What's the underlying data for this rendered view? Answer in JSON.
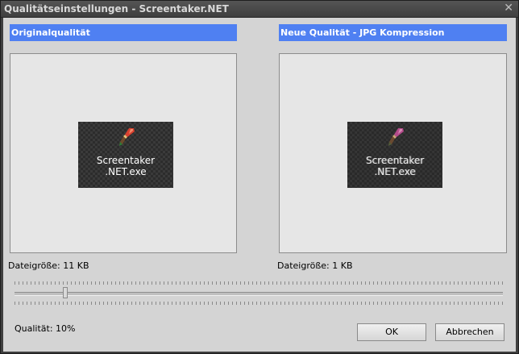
{
  "window": {
    "title": "Qualitätseinstellungen - Screentaker.NET"
  },
  "original": {
    "header": "Originalqualität",
    "thumb_label_line1": "Screentaker",
    "thumb_label_line2": ".NET.exe",
    "filesize": "Dateigröße: 11 KB"
  },
  "compressed": {
    "header": "Neue Qualität - JPG Kompression",
    "thumb_label_line1": "Screentaker",
    "thumb_label_line2": ".NET.exe",
    "filesize": "Dateigröße: 1 KB"
  },
  "slider": {
    "value_percent": 10
  },
  "quality_label": "Qualität: 10%",
  "buttons": {
    "ok": "OK",
    "cancel": "Abbrechen"
  },
  "colors": {
    "header_bg": "#4f80f2",
    "client_bg": "#d4d4d4",
    "title_bg": "#3f3f3f"
  }
}
